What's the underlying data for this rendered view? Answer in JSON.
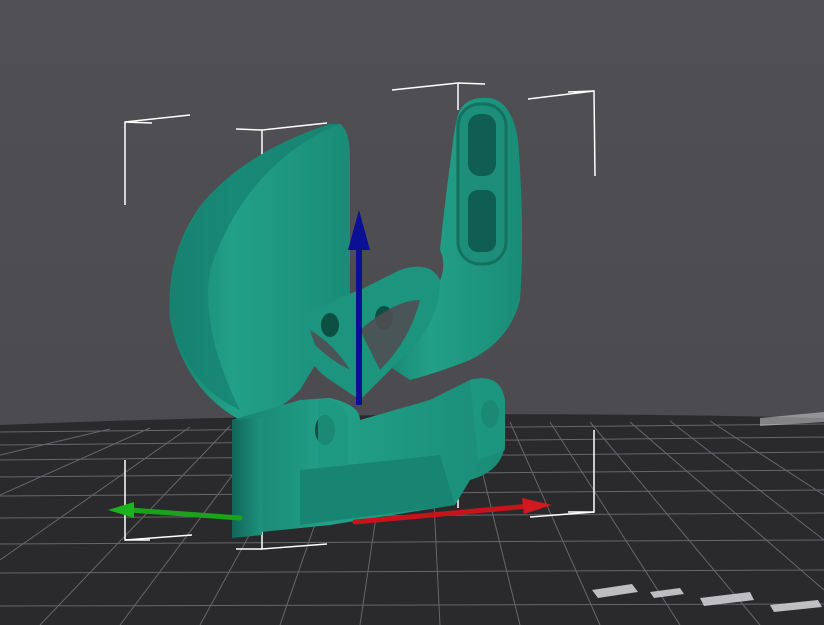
{
  "viewport": {
    "background_color": "#4f4e52",
    "bed_color": "#2b2b2e",
    "grid_color": "#6a6a6f",
    "model_color": "#1f9a84",
    "model_shadow_color": "#136a5b",
    "bounding_box_color": "#ffffff"
  },
  "axes": {
    "x_color": "#c8131a",
    "y_color": "#1aa31a",
    "z_color": "#0b0f96"
  },
  "icons": [
    "model-part-icon",
    "z-axis-arrow-icon",
    "x-axis-arrow-icon",
    "y-axis-arrow-icon"
  ]
}
